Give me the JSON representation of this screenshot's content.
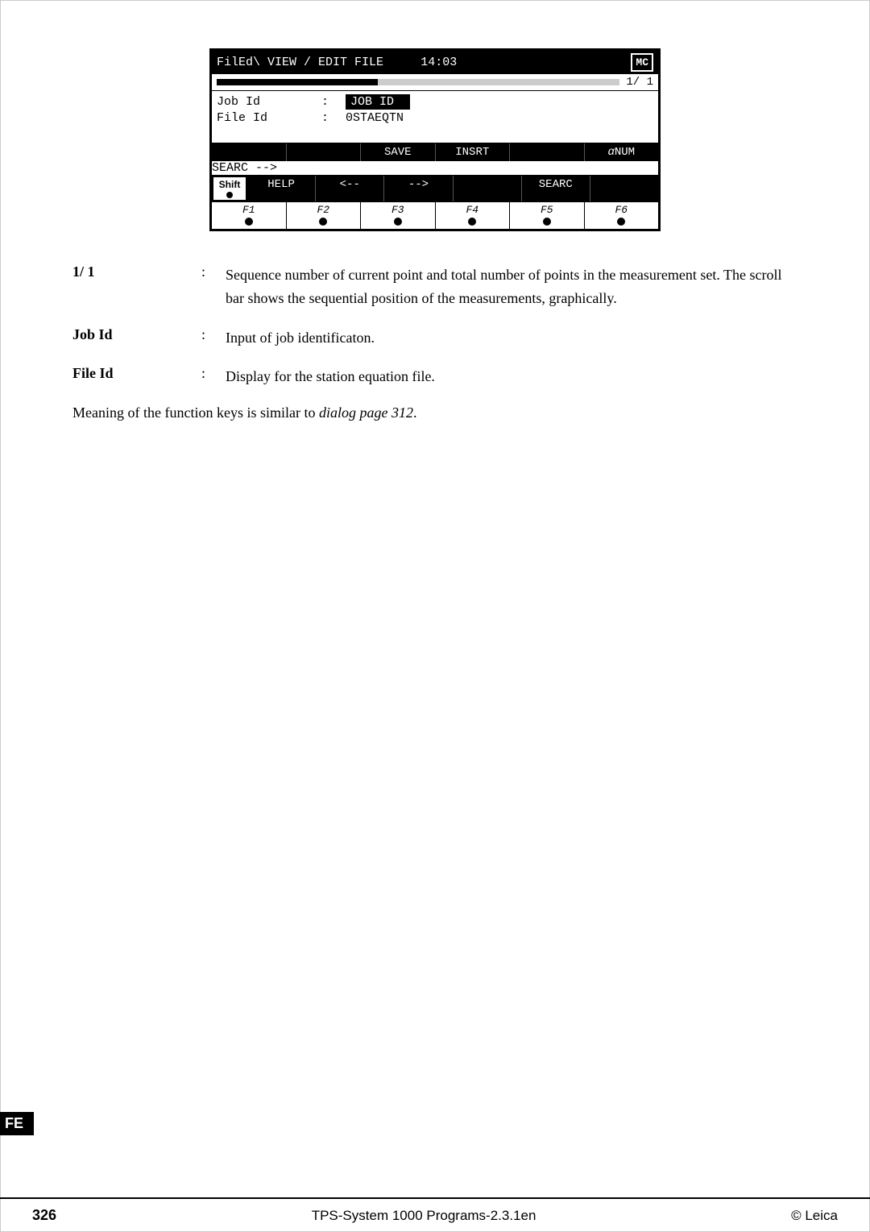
{
  "screen": {
    "titlebar": "FilEd\\ VIEW / EDIT FILE",
    "time": "14:03",
    "mc_label": "MC",
    "progress_page": "1/  1",
    "row1_label": "Job Id",
    "row1_colon": ":",
    "row1_value": "JOB ID",
    "row2_label": "File Id",
    "row2_colon": ":",
    "row2_value": "0STAEQTN",
    "fn_row1": [
      "",
      "",
      "SAVE",
      "INSRT",
      "",
      "αNUM"
    ],
    "shift_label": "Shift",
    "fn_row2": [
      "HELP",
      "<--",
      "-->",
      "",
      "SEARC",
      ""
    ],
    "fkeys": [
      "F1",
      "F2",
      "F3",
      "F4",
      "F5",
      "F6"
    ]
  },
  "descriptions": [
    {
      "term": "1/ 1",
      "colon": ":",
      "definition": "Sequence number of current point and total number of points in the measurement set. The scroll bar shows the sequential position of the measurements, graphically."
    },
    {
      "term": "Job Id",
      "colon": ":",
      "definition": "Input of job identificaton."
    },
    {
      "term": "File Id",
      "colon": ":",
      "definition": "Display for the station equation file."
    }
  ],
  "note": "Meaning of the function keys is similar to ",
  "note_italic": "dialog page 312",
  "note_end": ".",
  "fe_label": "FE",
  "footer": {
    "page": "326",
    "title": "TPS-System 1000 Programs-2.3.1en",
    "copyright": "© Leica"
  }
}
